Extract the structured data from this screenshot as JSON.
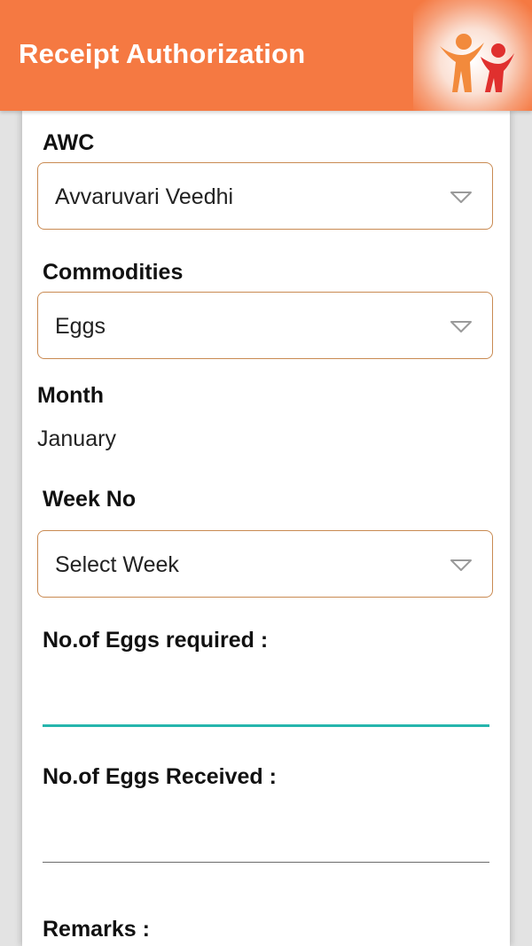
{
  "header": {
    "title": "Receipt Authorization"
  },
  "form": {
    "awc": {
      "label": "AWC",
      "selected": "Avvaruvari Veedhi"
    },
    "commodities": {
      "label": "Commodities",
      "selected": "Eggs"
    },
    "month": {
      "label": "Month",
      "value": "January"
    },
    "week": {
      "label": "Week No",
      "selected": "Select Week"
    },
    "eggs_required": {
      "label": "No.of Eggs required :",
      "value": ""
    },
    "eggs_received": {
      "label": "No.of Eggs Received :",
      "value": ""
    },
    "remarks": {
      "label": "Remarks :"
    }
  },
  "colors": {
    "header_bg": "#f57942",
    "dropdown_border": "#c98a52",
    "focused_underline": "#26b5ad"
  }
}
